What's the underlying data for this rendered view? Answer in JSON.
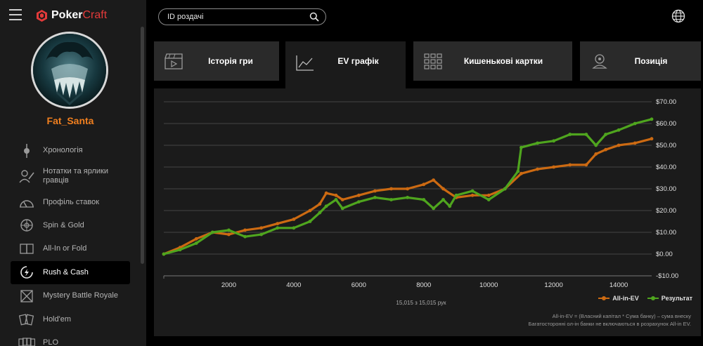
{
  "app": {
    "logo_poker": "Poker",
    "logo_craft": "Craft"
  },
  "user": {
    "name": "Fat_Santa"
  },
  "sidebar": {
    "items": [
      {
        "label": "Хронологія",
        "icon": "timeline-icon"
      },
      {
        "label": "Нотатки та ярлики гравців",
        "icon": "player-notes-icon"
      },
      {
        "label": "Профіль ставок",
        "icon": "gauge-icon"
      },
      {
        "label": "Spin & Gold",
        "icon": "spin-wheel-icon"
      },
      {
        "label": "All-In or Fold",
        "icon": "cards-icon"
      },
      {
        "label": "Rush & Cash",
        "icon": "rush-cash-icon",
        "active": true
      },
      {
        "label": "Mystery Battle Royale",
        "icon": "battle-crossed-icon"
      },
      {
        "label": "Hold'em",
        "icon": "holdem-cards-icon"
      },
      {
        "label": "PLO",
        "icon": "plo-cards-icon"
      }
    ]
  },
  "search": {
    "placeholder": "ID роздачі"
  },
  "tabs": [
    {
      "label": "Історія гри",
      "icon": "clapperboard-icon"
    },
    {
      "label": "EV графік",
      "icon": "line-chart-icon",
      "active": true
    },
    {
      "label": "Кишенькові картки",
      "icon": "grid-icon"
    },
    {
      "label": "Позиція",
      "icon": "position-icon"
    }
  ],
  "chart_data": {
    "type": "line",
    "title": "",
    "xlabel": "",
    "ylabel": "",
    "xlim": [
      0,
      15015
    ],
    "ylim": [
      -10,
      70
    ],
    "x_ticks": [
      2000,
      4000,
      6000,
      8000,
      10000,
      12000,
      14000
    ],
    "y_ticks": [
      "-$10.00",
      "$0.00",
      "$10.00",
      "$20.00",
      "$30.00",
      "$40.00",
      "$50.00",
      "$60.00",
      "$70.00"
    ],
    "y_tick_values": [
      -10,
      0,
      10,
      20,
      30,
      40,
      50,
      60,
      70
    ],
    "legend": "bottom-right",
    "grid": true,
    "series": [
      {
        "name": "All-in-EV",
        "color": "#cc6a12",
        "x": [
          0,
          500,
          1000,
          1500,
          2000,
          2500,
          3000,
          3500,
          4000,
          4500,
          4800,
          5000,
          5300,
          5500,
          6000,
          6500,
          7000,
          7500,
          8000,
          8300,
          8600,
          9000,
          9500,
          10000,
          10500,
          11000,
          11500,
          12000,
          12500,
          13000,
          13300,
          13600,
          14000,
          14500,
          15015
        ],
        "values": [
          0,
          3,
          7,
          10,
          9,
          11,
          12,
          14,
          16,
          20,
          23,
          28,
          27,
          25,
          27,
          29,
          30,
          30,
          32,
          34,
          30,
          26,
          27,
          27,
          30,
          37,
          39,
          40,
          41,
          41,
          46,
          48,
          50,
          51,
          53
        ]
      },
      {
        "name": "Результат",
        "color": "#4fa51e",
        "x": [
          0,
          500,
          1000,
          1500,
          2000,
          2500,
          3000,
          3500,
          4000,
          4500,
          4800,
          5000,
          5300,
          5500,
          6000,
          6500,
          7000,
          7500,
          8000,
          8300,
          8600,
          8800,
          9000,
          9500,
          10000,
          10500,
          10900,
          11000,
          11500,
          12000,
          12500,
          13000,
          13300,
          13600,
          14000,
          14500,
          15015
        ],
        "values": [
          0,
          2,
          5,
          10,
          11,
          8,
          9,
          12,
          12,
          15,
          19,
          22,
          25,
          21,
          24,
          26,
          25,
          26,
          25,
          21,
          25,
          22,
          27,
          29,
          25,
          30,
          38,
          49,
          51,
          52,
          55,
          55,
          50,
          55,
          57,
          60,
          62
        ]
      }
    ]
  },
  "chart_footer": {
    "hands": "15,015 з 15,015 рук",
    "note_line1": "All-in-EV = (Власний капітал * Сума банку) – сума внеску",
    "note_line2": "Багатосторонні ол-ін банки не включаються в розрахунок All-in EV."
  }
}
